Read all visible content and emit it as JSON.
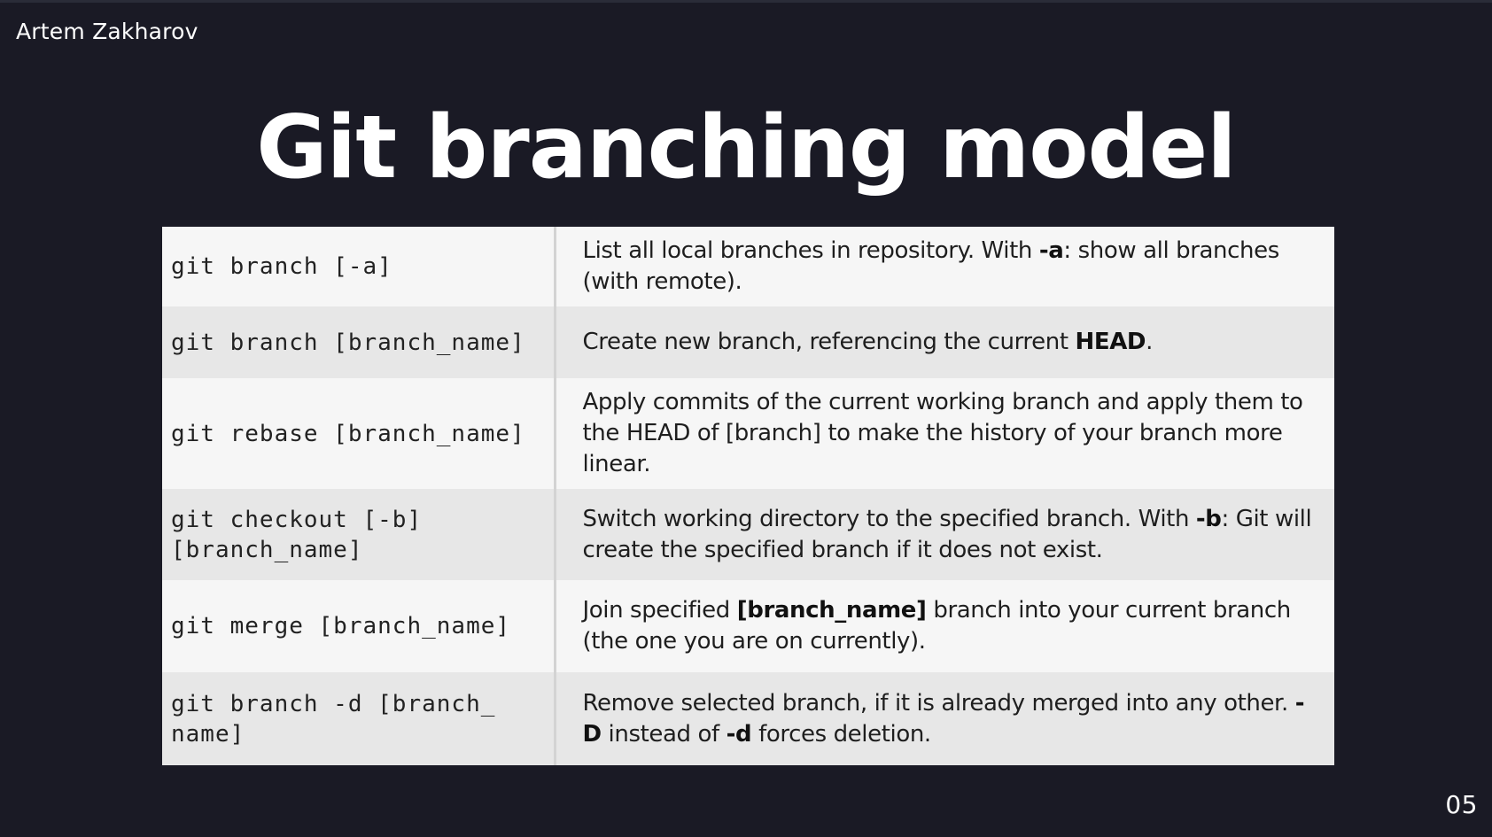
{
  "header": {
    "author": "Artem Zakharov"
  },
  "slide": {
    "title": "Git branching model",
    "page_number": "05"
  },
  "table": {
    "rows": [
      {
        "command_lines": [
          "git branch [-a]"
        ],
        "description": [
          {
            "t": "List all local branches in repository. With "
          },
          {
            "t": "-a",
            "b": true
          },
          {
            "t": ": show all branches (with remote)."
          }
        ]
      },
      {
        "command_lines": [
          "git branch [branch_name]"
        ],
        "description": [
          {
            "t": "Create new branch, referencing the current "
          },
          {
            "t": "HEAD",
            "b": true
          },
          {
            "t": "."
          }
        ]
      },
      {
        "command_lines": [
          "git rebase [branch_name]"
        ],
        "description": [
          {
            "t": "Apply commits of the current working branch and apply them to the HEAD of [branch] to make the history of your branch more linear."
          }
        ]
      },
      {
        "command_lines": [
          "git checkout [-b]",
          "[branch_name]"
        ],
        "description": [
          {
            "t": "Switch working directory to the specified branch. With "
          },
          {
            "t": "-b",
            "b": true
          },
          {
            "t": ": Git will create the specified branch if it does not exist."
          }
        ]
      },
      {
        "command_lines": [
          "git merge [branch_name]"
        ],
        "description": [
          {
            "t": "Join specified "
          },
          {
            "t": "[branch_name]",
            "b": true
          },
          {
            "t": " branch into your current branch (the one you are on currently)."
          }
        ]
      },
      {
        "command_lines": [
          "git branch -d [branch_",
          "name]"
        ],
        "description": [
          {
            "t": "Remove selected branch, if it is already merged into any other. "
          },
          {
            "t": "-D",
            "b": true
          },
          {
            "t": " instead of "
          },
          {
            "t": "-d",
            "b": true
          },
          {
            "t": " forces deletion."
          }
        ]
      }
    ]
  }
}
